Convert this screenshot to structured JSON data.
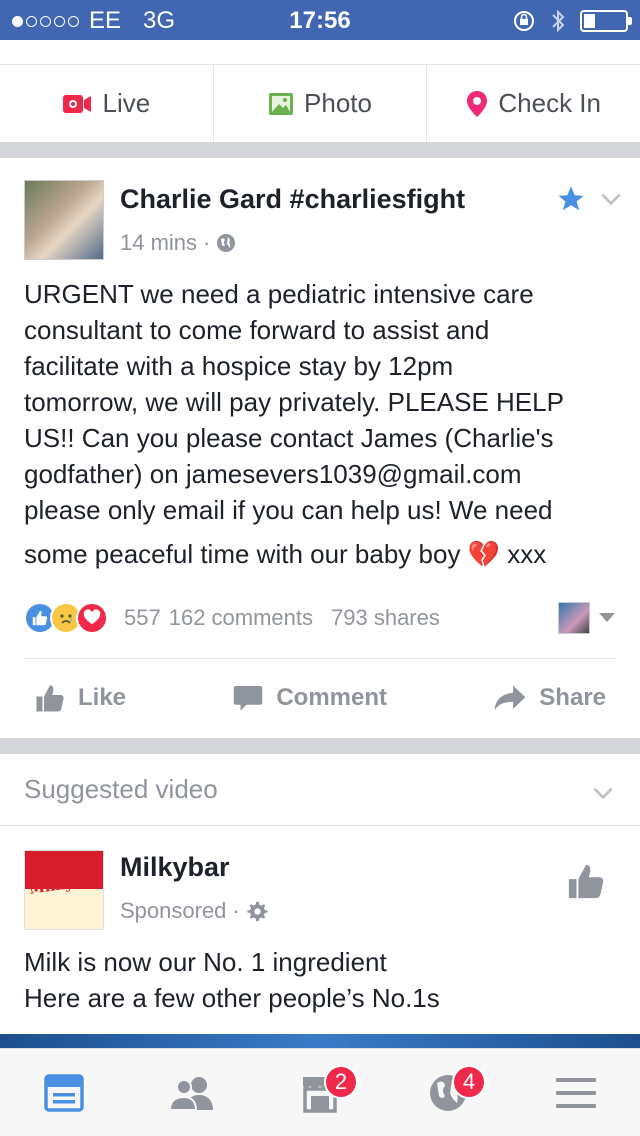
{
  "status_bar": {
    "carrier": "EE",
    "network": "3G",
    "time": "17:56",
    "signal_bars_filled": 1,
    "signal_bars_total": 5,
    "battery_level": 0.25
  },
  "composer": {
    "items": [
      {
        "label": "Live",
        "icon": "live-video-icon",
        "color": "#f02849"
      },
      {
        "label": "Photo",
        "icon": "photo-icon",
        "color": "#6bb04c"
      },
      {
        "label": "Check In",
        "icon": "location-pin-icon",
        "color": "#f02875"
      }
    ]
  },
  "post": {
    "author": "Charlie Gard #charliesfight",
    "time": "14 mins",
    "text_lines": [
      "URGENT we need a pediatric intensive care",
      "consultant to come forward to assist and",
      "facilitate with a hospice stay by 12pm",
      "tomorrow, we will pay privately. PLEASE HELP",
      "US!! Can you please contact James (Charlie's",
      "godfather) on jamesevers1039@gmail.com",
      "please only email if you can help us! We need",
      "some peaceful time with our baby boy 💔  xxx"
    ],
    "reaction_count": "557",
    "comments": "162 comments",
    "shares": "793 shares",
    "actions": {
      "like": "Like",
      "comment": "Comment",
      "share": "Share"
    }
  },
  "suggested": {
    "title": "Suggested video",
    "advertiser": "Milkybar",
    "logo_text": "Milkybar",
    "sponsored": "Sponsored",
    "text_lines": [
      "Milk is now our No. 1 ingredient",
      "Here are a few other people’s No.1s"
    ]
  },
  "tab_bar": {
    "tabs": [
      {
        "name": "news-feed",
        "badge": ""
      },
      {
        "name": "friend-requests",
        "badge": ""
      },
      {
        "name": "marketplace",
        "badge": "2"
      },
      {
        "name": "notifications",
        "badge": "4"
      },
      {
        "name": "more-menu",
        "badge": ""
      }
    ]
  },
  "colors": {
    "brand_blue": "#4267b2",
    "tab_active": "#4a90e2",
    "badge_red": "#f02849"
  }
}
